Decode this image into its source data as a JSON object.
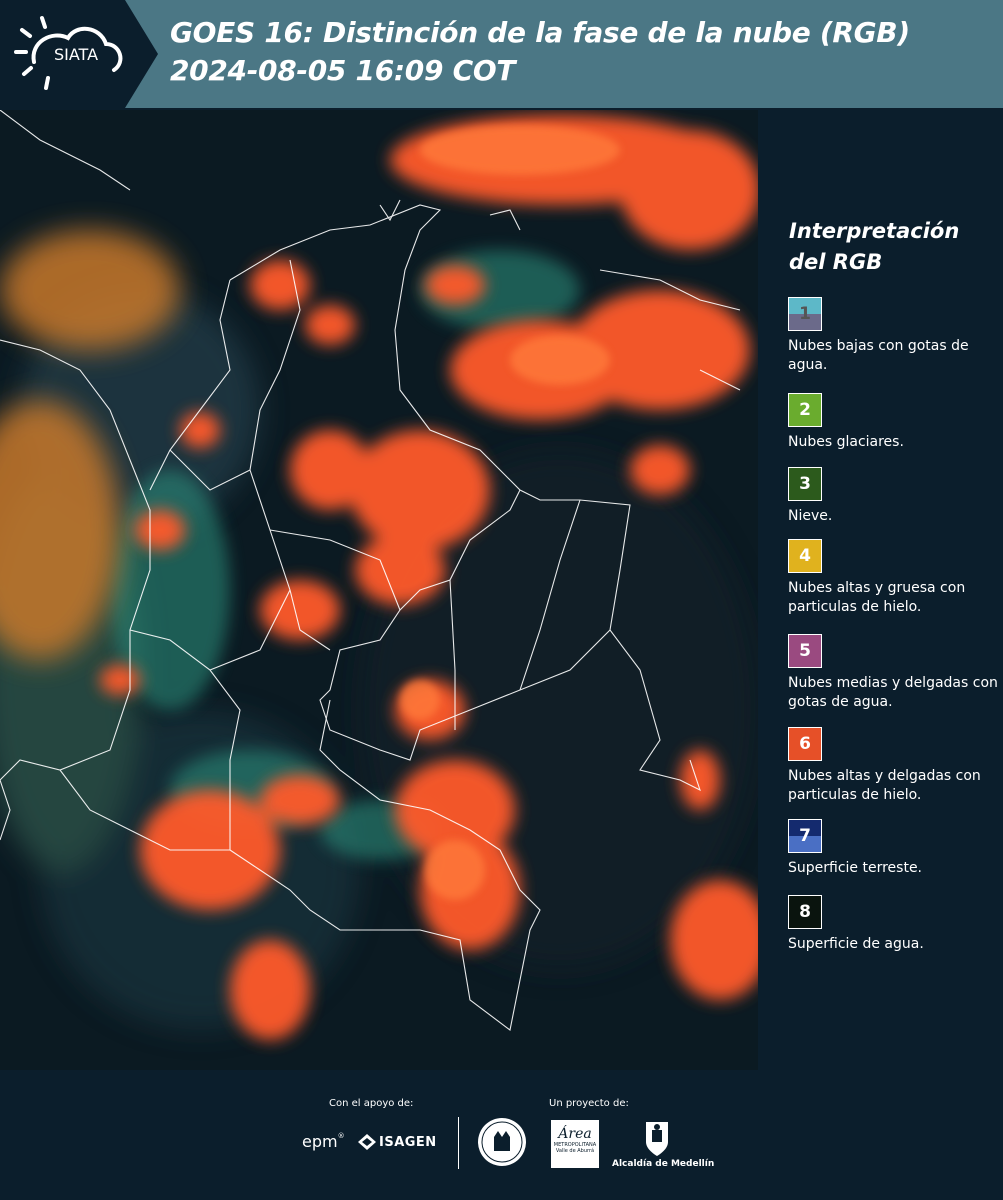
{
  "header": {
    "logo_text": "SIATA",
    "title_line1": "GOES 16: Distinción de la fase de la nube (RGB)",
    "title_line2": " 2024-08-05 16:09 COT"
  },
  "colors": {
    "header_bg": "#4b7785",
    "panel_bg": "#0b1e2c",
    "cloud_orange": "#ff5a2a",
    "border_white": "#ffffff"
  },
  "legend": {
    "title_line1": "Interpretación",
    "title_line2": "del RGB",
    "items": [
      {
        "num": "1",
        "desc": "Nubes bajas con gotas de agua.",
        "color_top": "#5db8c8",
        "color_bottom": "#6b6a8a"
      },
      {
        "num": "2",
        "desc": "Nubes glaciares.",
        "color_top": "#6aac2e",
        "color_bottom": "#6aac2e"
      },
      {
        "num": "3",
        "desc": "Nieve.",
        "color_top": "#2c5a1c",
        "color_bottom": "#2c5a1c"
      },
      {
        "num": "4",
        "desc": "Nubes altas y gruesa con particulas de hielo.",
        "color_top": "#e0b21e",
        "color_bottom": "#e0b21e"
      },
      {
        "num": "5",
        "desc": "Nubes medias y delgadas con gotas de agua.",
        "color_top": "#9a4a80",
        "color_bottom": "#9a4a80"
      },
      {
        "num": "6",
        "desc": "Nubes altas y delgadas con particulas de hielo.",
        "color_top": "#e65028",
        "color_bottom": "#e65028"
      },
      {
        "num": "7",
        "desc": "Superficie terreste.",
        "color_top": "#142a6e",
        "color_bottom": "#4a6fc4"
      },
      {
        "num": "8",
        "desc": "Superficie de agua.",
        "color_top": "#0a140e",
        "color_bottom": "#0a140e"
      }
    ]
  },
  "footer": {
    "support_label": "Con el apoyo de:",
    "project_label": "Un proyecto de:",
    "sponsor_epm": "epm",
    "sponsor_isagen": "ISAGEN",
    "area_metro_name": "Área",
    "area_metro_sub1": "METROPOLITANA",
    "area_metro_sub2": "Valle de Aburrá",
    "alcaldia": "Alcaldía de Medellín"
  }
}
